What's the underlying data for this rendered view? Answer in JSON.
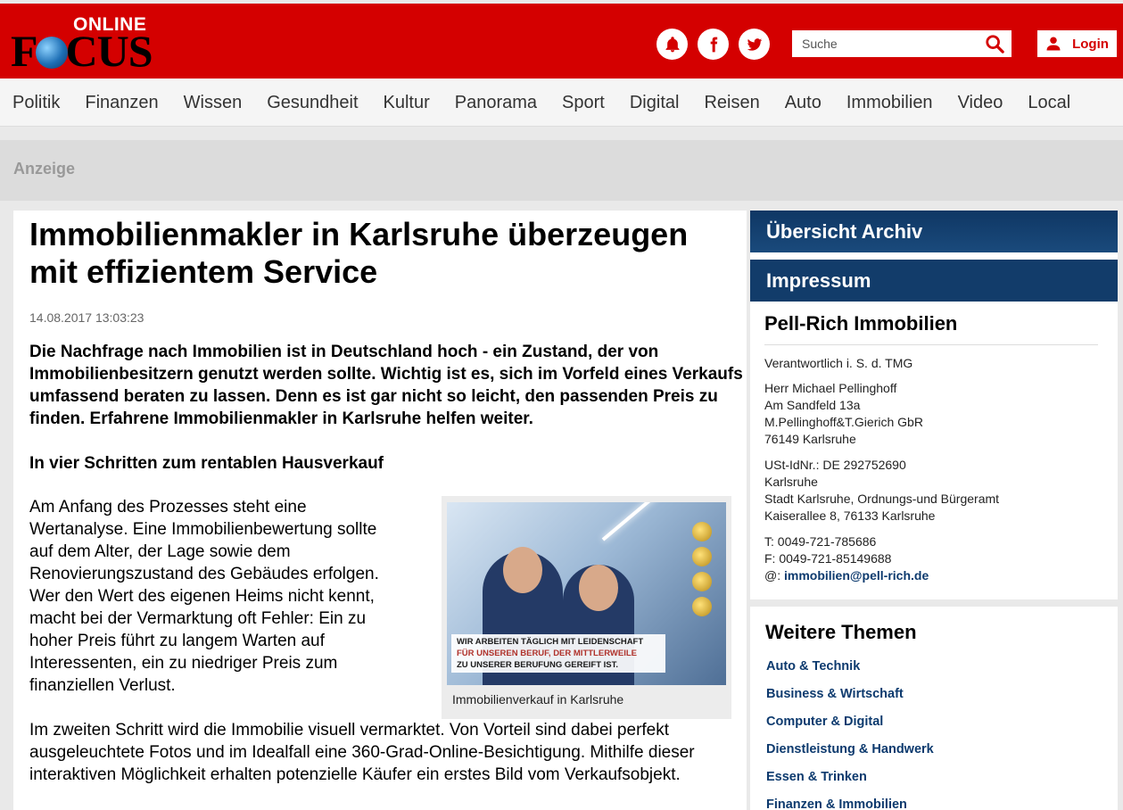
{
  "header": {
    "logo_online": "ONLINE",
    "logo_brand_left": "F",
    "logo_brand_right": "CUS",
    "search_placeholder": "Suche",
    "login_label": "Login",
    "colors": {
      "brand_red": "#d40000",
      "navy": "#123c6a"
    }
  },
  "nav": [
    "Politik",
    "Finanzen",
    "Wissen",
    "Gesundheit",
    "Kultur",
    "Panorama",
    "Sport",
    "Digital",
    "Reisen",
    "Auto",
    "Immobilien",
    "Video",
    "Local"
  ],
  "ad": {
    "label": "Anzeige"
  },
  "article": {
    "title": "Immobilienmakler in Karlsruhe überzeugen mit effizientem Service",
    "date": "14.08.2017 13:03:23",
    "lead": "Die Nachfrage nach Immobilien ist in Deutschland hoch - ein Zustand, der von Immobilienbesitzern genutzt werden sollte. Wichtig ist es, sich im Vorfeld eines Verkaufs umfassend beraten zu lassen. Denn es ist gar nicht so leicht, den passenden Preis zu finden. Erfahrene Immobilienmakler in Karlsruhe helfen weiter.",
    "subhead": "In vier Schritten zum rentablen Hausverkauf",
    "p1": "Am Anfang des Prozesses steht eine Wertanalyse. Eine Immobilienbewertung sollte auf dem Alter, der Lage sowie dem Renovierungszustand des Gebäudes erfolgen. Wer den Wert des eigenen Heims nicht kennt, macht bei der Vermarktung oft Fehler: Ein zu hoher Preis führt zu langem Warten auf Interessenten, ein zu niedriger Preis zum finanziellen Verlust.",
    "p2": "Im zweiten Schritt wird die Immobilie visuell vermarktet. Von Vorteil sind dabei perfekt ausgeleuchtete Fotos und im Idealfall eine 360-Grad-Online-Besichtigung. Mithilfe dieser interaktiven Möglichkeit erhalten potenzielle Käufer ein erstes Bild vom Verkaufsobjekt.",
    "figure": {
      "banner_line1": "WIR ARBEITEN TÄGLICH MIT LEIDENSCHAFT",
      "banner_line2": "FÜR UNSEREN BERUF, DER MITTLERWEILE",
      "banner_line3": "ZU UNSERER BERUFUNG GEREIFT IST.",
      "caption": "Immobilienverkauf in Karlsruhe"
    }
  },
  "sidebar": {
    "archive": "Übersicht Archiv",
    "impressum": "Impressum",
    "company": "Pell-Rich Immobilien",
    "responsible": "Verantwortlich i. S. d. TMG",
    "address": [
      "Herr Michael Pellinghoff",
      "Am Sandfeld 13a",
      "M.Pellinghoff&T.Gierich GbR",
      "76149 Karlsruhe"
    ],
    "tax": [
      "USt-IdNr.: DE 292752690",
      "Karlsruhe",
      "Stadt Karlsruhe, Ordnungs-und Bürgeramt",
      "Kaiserallee 8, 76133 Karlsruhe"
    ],
    "phone": "T: 0049-721-785686",
    "fax": "F: 0049-721-85149688",
    "email_prefix": "@:",
    "email": "immobilien@pell-rich.de",
    "more_title": "Weitere Themen",
    "topics": [
      "Auto & Technik",
      "Business & Wirtschaft",
      "Computer & Digital",
      "Dienstleistung & Handwerk",
      "Essen & Trinken",
      "Finanzen & Immobilien"
    ]
  }
}
